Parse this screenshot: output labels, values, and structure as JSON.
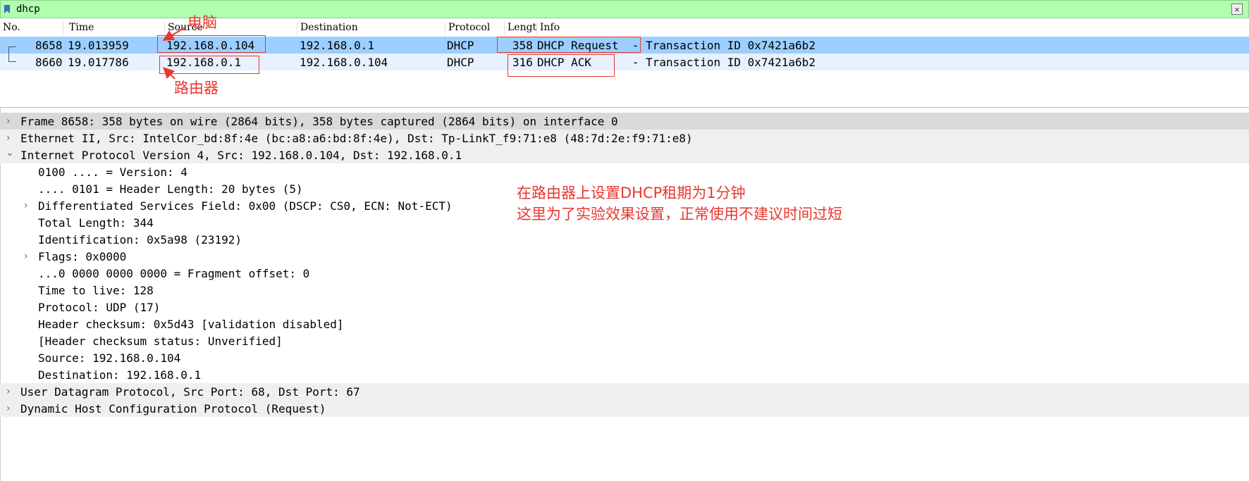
{
  "filter": {
    "text": "dhcp",
    "clear_icon": "×"
  },
  "columns": [
    "No.",
    "Time",
    "Source",
    "Destination",
    "Protocol",
    "Lengt",
    "Info"
  ],
  "packets": [
    {
      "no": "8658",
      "time": "19.013959",
      "source": "192.168.0.104",
      "destination": "192.168.0.1",
      "protocol": "DHCP",
      "length": "358",
      "info": "DHCP Request  - Transaction ID 0x7421a6b2"
    },
    {
      "no": "8660",
      "time": "19.017786",
      "source": "192.168.0.1",
      "destination": "192.168.0.104",
      "protocol": "DHCP",
      "length": "316",
      "info": "DHCP ACK      - Transaction ID 0x7421a6b2"
    }
  ],
  "details": [
    {
      "text": "Frame 8658: 358 bytes on wire (2864 bits), 358 bytes captured (2864 bits) on interface 0",
      "arrow": "›"
    },
    {
      "text": "Ethernet II, Src: IntelCor_bd:8f:4e (bc:a8:a6:bd:8f:4e), Dst: Tp-LinkT_f9:71:e8 (48:7d:2e:f9:71:e8)",
      "arrow": "›"
    },
    {
      "text": "Internet Protocol Version 4, Src: 192.168.0.104, Dst: 192.168.0.1",
      "arrow": "⌄"
    },
    {
      "text": "0100 .... = Version: 4",
      "arrow": ""
    },
    {
      "text": ".... 0101 = Header Length: 20 bytes (5)",
      "arrow": ""
    },
    {
      "text": "Differentiated Services Field: 0x00 (DSCP: CS0, ECN: Not-ECT)",
      "arrow": "›"
    },
    {
      "text": "Total Length: 344",
      "arrow": ""
    },
    {
      "text": "Identification: 0x5a98 (23192)",
      "arrow": ""
    },
    {
      "text": "Flags: 0x0000",
      "arrow": "›"
    },
    {
      "text": "...0 0000 0000 0000 = Fragment offset: 0",
      "arrow": ""
    },
    {
      "text": "Time to live: 128",
      "arrow": ""
    },
    {
      "text": "Protocol: UDP (17)",
      "arrow": ""
    },
    {
      "text": "Header checksum: 0x5d43 [validation disabled]",
      "arrow": ""
    },
    {
      "text": "[Header checksum status: Unverified]",
      "arrow": ""
    },
    {
      "text": "Source: 192.168.0.104",
      "arrow": ""
    },
    {
      "text": "Destination: 192.168.0.1",
      "arrow": ""
    },
    {
      "text": "User Datagram Protocol, Src Port: 68, Dst Port: 67",
      "arrow": "›"
    },
    {
      "text": "Dynamic Host Configuration Protocol (Request)",
      "arrow": "›"
    }
  ],
  "annotations": {
    "pc_label": "电脑",
    "router_label": "路由器",
    "note_line1": "在路由器上设置DHCP租期为1分钟",
    "note_line2": "这里为了实验效果设置，正常使用不建议时间过短"
  },
  "colors": {
    "filter_bg": "#afffaf",
    "selected_row": "#9ccfff",
    "annotation": "#e8372f"
  }
}
